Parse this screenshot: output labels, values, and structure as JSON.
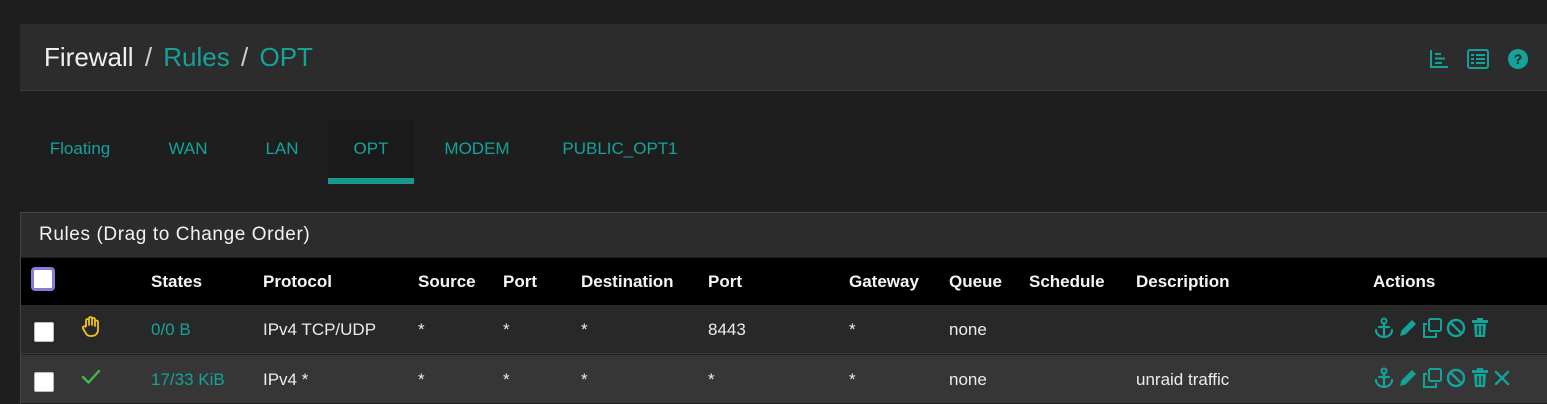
{
  "breadcrumb": {
    "part1": "Firewall",
    "sep1": "/",
    "part2": "Rules",
    "sep2": "/",
    "part3": "OPT"
  },
  "header_icons": [
    "list-view-icon",
    "table-icon",
    "help-icon"
  ],
  "tabs": [
    {
      "label": "Floating",
      "active": false
    },
    {
      "label": "WAN",
      "active": false
    },
    {
      "label": "LAN",
      "active": false
    },
    {
      "label": "OPT",
      "active": true
    },
    {
      "label": "MODEM",
      "active": false
    },
    {
      "label": "PUBLIC_OPT1",
      "active": false
    }
  ],
  "panel": {
    "title": "Rules (Drag to Change Order)"
  },
  "columns": {
    "states": "States",
    "protocol": "Protocol",
    "source": "Source",
    "port": "Port",
    "destination": "Destination",
    "dest_port": "Port",
    "gateway": "Gateway",
    "queue": "Queue",
    "schedule": "Schedule",
    "description": "Description",
    "actions": "Actions"
  },
  "rows": [
    {
      "status_icon": "hand-block-icon",
      "states": "0/0 B",
      "protocol": "IPv4 TCP/UDP",
      "source": "*",
      "port": "*",
      "destination": "*",
      "dest_port": "8443",
      "gateway": "*",
      "queue": "none",
      "schedule": "",
      "description": "",
      "actions": [
        "anchor-icon",
        "edit-pencil-icon",
        "copy-icon",
        "disable-icon",
        "trash-icon"
      ]
    },
    {
      "status_icon": "check-pass-icon",
      "states": "17/33 KiB",
      "protocol": "IPv4 *",
      "source": "*",
      "port": "*",
      "destination": "*",
      "dest_port": "*",
      "gateway": "*",
      "queue": "none",
      "schedule": "",
      "description": "unraid traffic",
      "actions": [
        "anchor-icon",
        "edit-pencil-icon",
        "copy-icon",
        "disable-icon",
        "trash-icon",
        "close-icon"
      ]
    }
  ],
  "colors": {
    "accent": "#14a39a",
    "block_icon": "#f0c419",
    "pass_icon": "#3fb950",
    "header_bg": "#000000"
  }
}
